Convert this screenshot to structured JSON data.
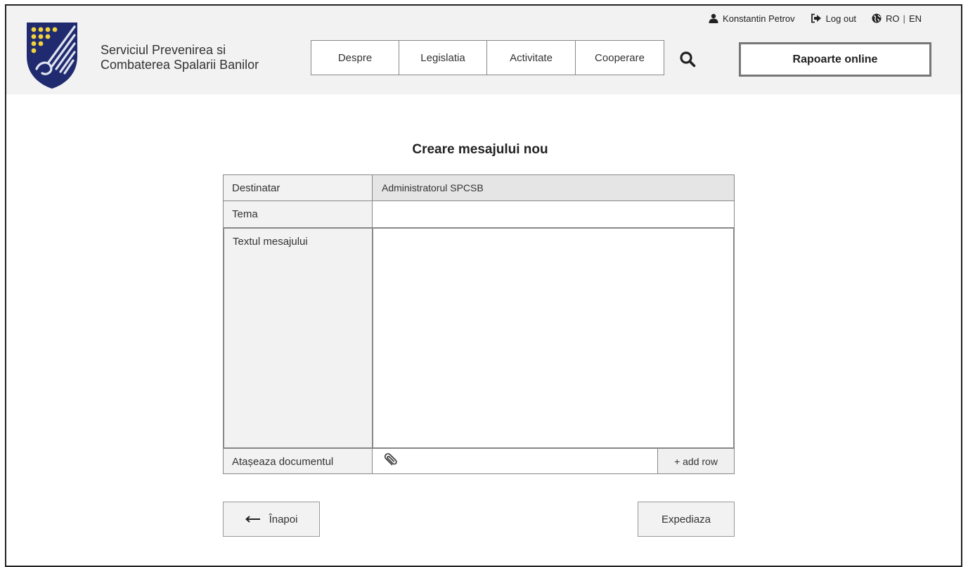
{
  "header": {
    "org_name_line1": "Serviciul Prevenirea si",
    "org_name_line2": "Combaterea Spalarii Banilor",
    "user_name": "Konstantin Petrov",
    "logout_label": "Log out",
    "lang_ro": "RO",
    "lang_sep": "|",
    "lang_en": "EN",
    "nav": [
      {
        "label": "Despre"
      },
      {
        "label": "Legislatia"
      },
      {
        "label": "Activitate"
      },
      {
        "label": "Cooperare"
      }
    ],
    "reports_button": "Rapoarte online"
  },
  "form": {
    "title": "Creare mesajului nou",
    "recipient_label": "Destinatar",
    "recipient_value": "Administratorul SPCSB",
    "subject_label": "Tema",
    "subject_value": "",
    "message_label": "Textul mesajului",
    "message_value": "",
    "attach_label": "Atașeaza documentul",
    "add_row_label": "+ add row"
  },
  "actions": {
    "back_label": "Înapoi",
    "send_label": "Expediaza"
  },
  "icons": [
    "user-icon",
    "logout-icon",
    "globe-icon",
    "search-icon",
    "paperclip-icon",
    "arrow-left-icon",
    "logo-emblem"
  ],
  "colors": {
    "header_bg": "#f2f2f2",
    "label_bg": "#f2f2f2",
    "readonly_bg": "#e5e5e5",
    "logo_blue": "#1f2b6e",
    "logo_yellow": "#f2d23c",
    "border": "#888888"
  }
}
